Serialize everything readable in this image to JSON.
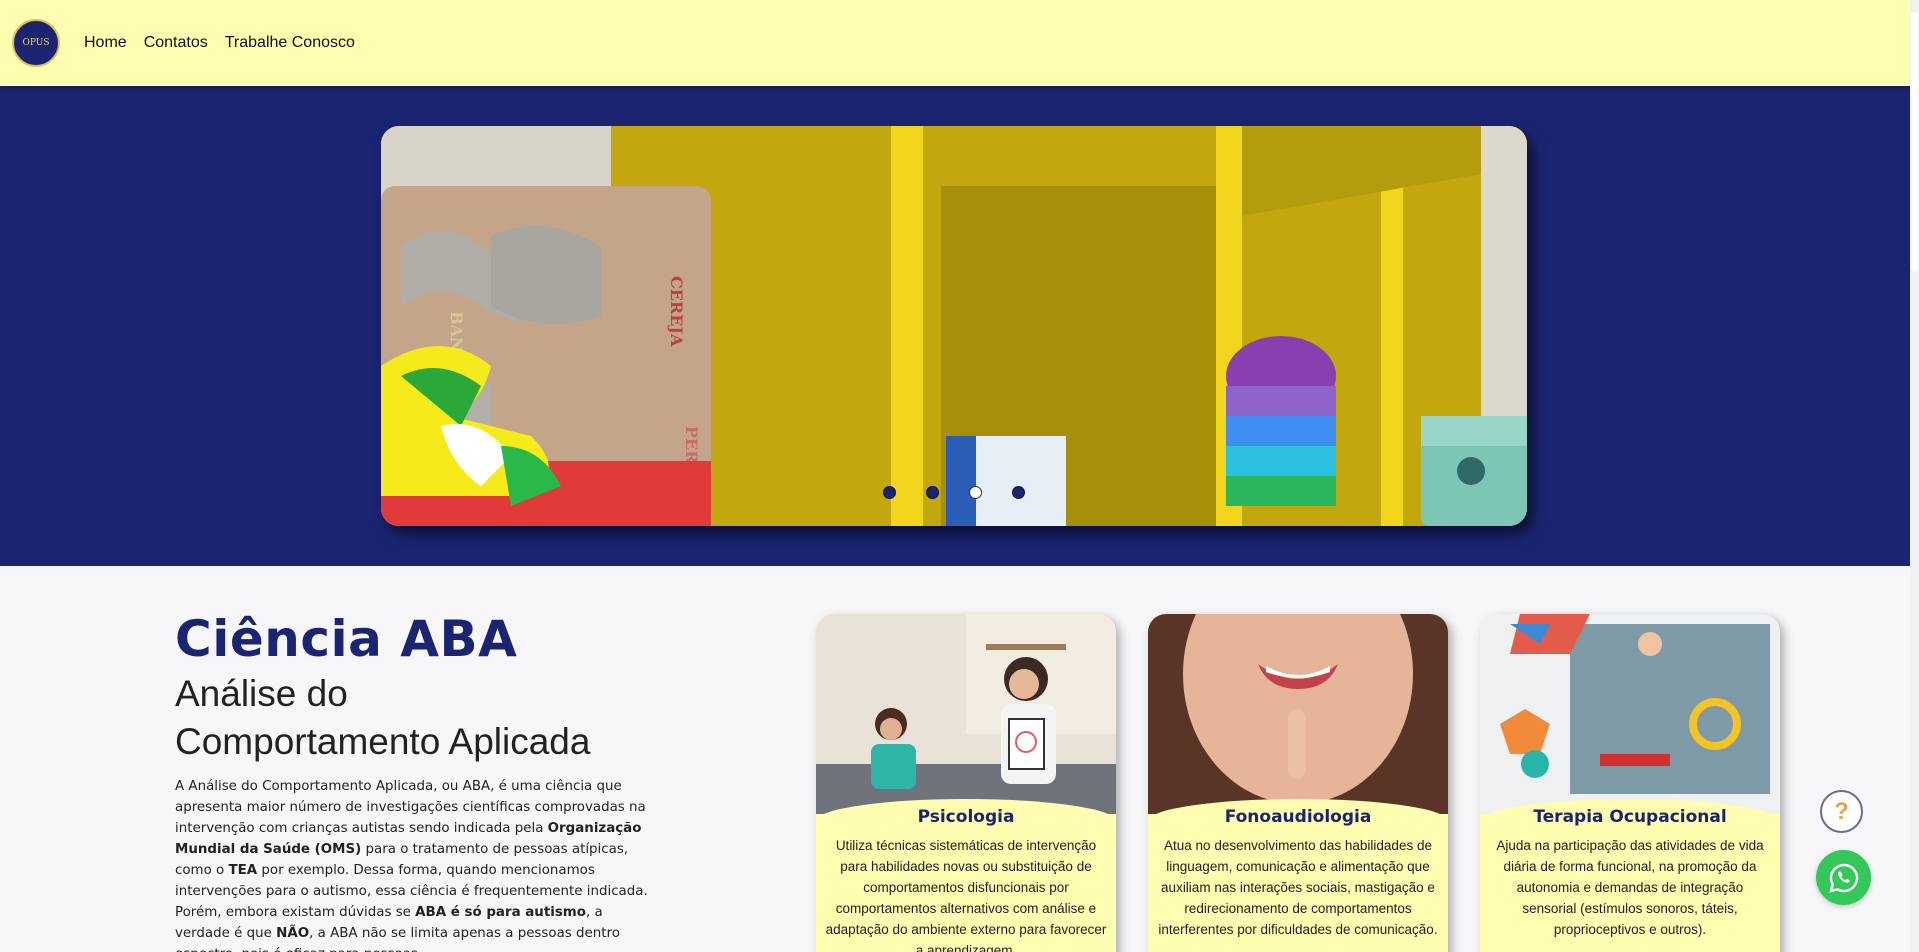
{
  "header": {
    "logo_text": "OPUS",
    "nav": [
      {
        "label": "Home"
      },
      {
        "label": "Contatos"
      },
      {
        "label": "Trabalhe Conosco"
      }
    ]
  },
  "carousel": {
    "slides": 4,
    "active_index": 2,
    "box_labels": [
      "BANANA",
      "CEREJA",
      "PERA"
    ]
  },
  "aba": {
    "title": "Ciência ABA",
    "subtitle_line1": "Análise do",
    "subtitle_line2": "Comportamento Aplicada",
    "p1": "A Análise do Comportamento Aplicada, ou ABA, é uma ciência que apresenta maior número de investigações científicas comprovadas na intervenção com crianças autistas sendo indicada pela ",
    "p_oms": "Organização Mundial da Saúde (OMS)",
    "p2": " para o tratamento de pessoas atípicas, como o ",
    "p_tea": "TEA",
    "p3": " por exemplo. Dessa forma, quando mencionamos intervenções para o autismo, essa ciência é frequentemente indicada. Porém, embora existam dúvidas se ",
    "p_aba": "ABA é só para autismo",
    "p4": ", a verdade é que ",
    "p_nao": "NÃO",
    "p5": ", a ABA não se limita apenas a pessoas dentro espectro, pois é eficaz para pessoas"
  },
  "cards": [
    {
      "title": "Psicologia",
      "text": "Utiliza técnicas sistemáticas de intervenção para habilidades novas ou substituição de comportamentos disfuncionais por comportamentos alternativos com análise e adaptação do ambiente externo para favorecer a aprendizagem."
    },
    {
      "title": "Fonoaudiologia",
      "text": "Atua no desenvolvimento das habilidades de linguagem, comunicação e alimentação que auxiliam nas interações sociais, mastigação e redirecionamento de comportamentos interferentes por dificuldades de comunicação."
    },
    {
      "title": "Terapia Ocupacional",
      "text": "Ajuda na participação das atividades de vida diária de forma funcional, na promoção da autonomia e demandas de integração sensorial (estímulos sonoros, táteis, proprioceptivos e outros)."
    }
  ],
  "floating": {
    "help_icon": "?",
    "whatsapp_icon": "whatsapp-icon"
  },
  "colors": {
    "navy": "#1b2470",
    "header_yellow": "#fffdb0",
    "whatsapp_green": "#34c759"
  }
}
